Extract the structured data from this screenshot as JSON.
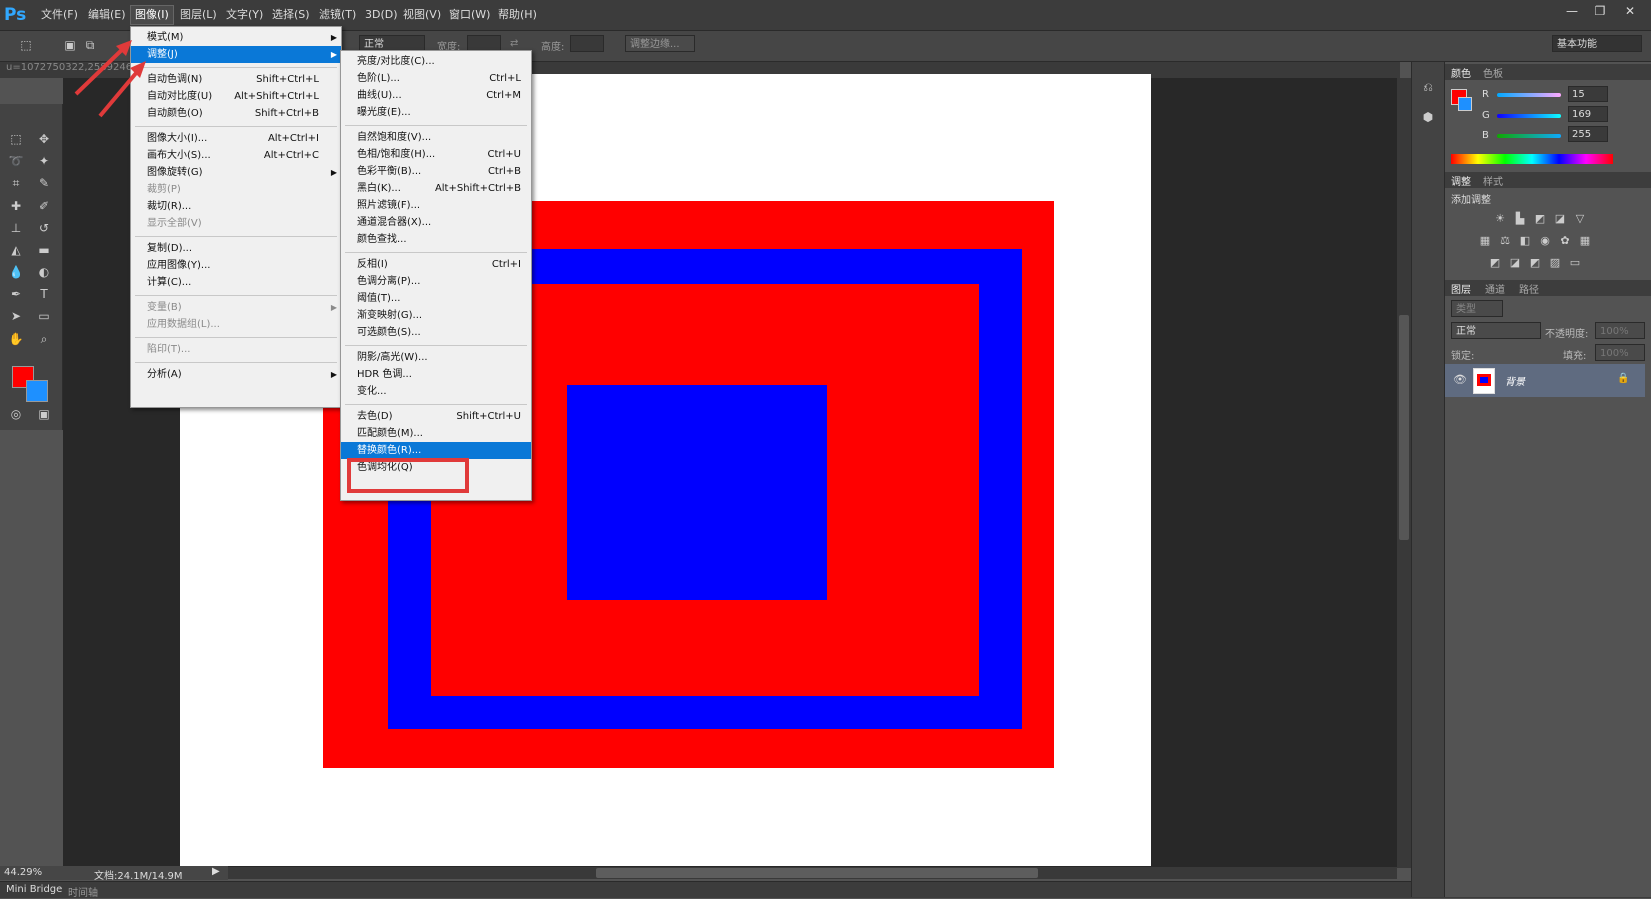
{
  "app": {
    "logo": "Ps"
  },
  "menubar": {
    "items": [
      "文件(F)",
      "编辑(E)",
      "图像(I)",
      "图层(L)",
      "文字(Y)",
      "选择(S)",
      "滤镜(T)",
      "3D(D)",
      "视图(V)",
      "窗口(W)",
      "帮助(H)"
    ],
    "active_index": 2
  },
  "window_controls": {
    "minimize": "—",
    "restore": "❐",
    "close": "✕"
  },
  "options_bar": {
    "style_value": "正常",
    "width_label": "宽度:",
    "height_label": "高度:",
    "refine_edge": "调整边缘...",
    "workspace": "基本功能"
  },
  "document_tab": {
    "title": "u=1072750322,2589246..."
  },
  "status": {
    "zoom": "44.29%",
    "doc_info": "文档:24.1M/14.9M"
  },
  "bottom_tabs": [
    "Mini Bridge",
    "时间轴"
  ],
  "colors": {
    "foreground": "#ff0000",
    "background": "#1e90ff",
    "canvas_red": "#ff0000",
    "canvas_blue": "#0000ff",
    "menu_highlight": "#0a78d7",
    "annotation": "#e03a3a"
  },
  "image_menu": {
    "items": [
      {
        "label": "模式(M)",
        "shortcut": "",
        "submenu": true,
        "disabled": false
      },
      {
        "label": "调整(J)",
        "shortcut": "",
        "submenu": true,
        "disabled": false,
        "highlighted": true
      },
      {
        "label": "自动色调(N)",
        "shortcut": "Shift+Ctrl+L"
      },
      {
        "label": "自动对比度(U)",
        "shortcut": "Alt+Shift+Ctrl+L"
      },
      {
        "label": "自动颜色(O)",
        "shortcut": "Shift+Ctrl+B"
      },
      {
        "label": "图像大小(I)...",
        "shortcut": "Alt+Ctrl+I"
      },
      {
        "label": "画布大小(S)...",
        "shortcut": "Alt+Ctrl+C"
      },
      {
        "label": "图像旋转(G)",
        "shortcut": "",
        "submenu": true
      },
      {
        "label": "裁剪(P)",
        "shortcut": "",
        "disabled": true
      },
      {
        "label": "裁切(R)...",
        "shortcut": ""
      },
      {
        "label": "显示全部(V)",
        "shortcut": "",
        "disabled": true
      },
      {
        "label": "复制(D)...",
        "shortcut": ""
      },
      {
        "label": "应用图像(Y)...",
        "shortcut": ""
      },
      {
        "label": "计算(C)...",
        "shortcut": ""
      },
      {
        "label": "变量(B)",
        "shortcut": "",
        "submenu": true,
        "disabled": true
      },
      {
        "label": "应用数据组(L)...",
        "shortcut": "",
        "disabled": true
      },
      {
        "label": "陷印(T)...",
        "shortcut": "",
        "disabled": true
      },
      {
        "label": "分析(A)",
        "shortcut": "",
        "submenu": true
      }
    ]
  },
  "adjust_menu": {
    "items": [
      {
        "label": "亮度/对比度(C)...",
        "shortcut": ""
      },
      {
        "label": "色阶(L)...",
        "shortcut": "Ctrl+L"
      },
      {
        "label": "曲线(U)...",
        "shortcut": "Ctrl+M"
      },
      {
        "label": "曝光度(E)...",
        "shortcut": ""
      },
      {
        "label": "自然饱和度(V)...",
        "shortcut": ""
      },
      {
        "label": "色相/饱和度(H)...",
        "shortcut": "Ctrl+U"
      },
      {
        "label": "色彩平衡(B)...",
        "shortcut": "Ctrl+B"
      },
      {
        "label": "黑白(K)...",
        "shortcut": "Alt+Shift+Ctrl+B"
      },
      {
        "label": "照片滤镜(F)...",
        "shortcut": ""
      },
      {
        "label": "通道混合器(X)...",
        "shortcut": ""
      },
      {
        "label": "颜色查找...",
        "shortcut": ""
      },
      {
        "label": "反相(I)",
        "shortcut": "Ctrl+I"
      },
      {
        "label": "色调分离(P)...",
        "shortcut": ""
      },
      {
        "label": "阈值(T)...",
        "shortcut": ""
      },
      {
        "label": "渐变映射(G)...",
        "shortcut": ""
      },
      {
        "label": "可选颜色(S)...",
        "shortcut": ""
      },
      {
        "label": "阴影/高光(W)...",
        "shortcut": ""
      },
      {
        "label": "HDR 色调...",
        "shortcut": ""
      },
      {
        "label": "变化...",
        "shortcut": ""
      },
      {
        "label": "去色(D)",
        "shortcut": "Shift+Ctrl+U"
      },
      {
        "label": "匹配颜色(M)...",
        "shortcut": ""
      },
      {
        "label": "替换颜色(R)...",
        "shortcut": "",
        "highlighted": true
      },
      {
        "label": "色调均化(Q)",
        "shortcut": ""
      }
    ]
  },
  "color_panel": {
    "tabs": [
      "颜色",
      "色板"
    ],
    "r_label": "R",
    "g_label": "G",
    "b_label": "B",
    "r": "15",
    "g": "169",
    "b": "255"
  },
  "adjustments_panel": {
    "tabs": [
      "调整",
      "样式"
    ],
    "heading": "添加调整"
  },
  "layers_panel": {
    "tabs": [
      "图层",
      "通道",
      "路径"
    ],
    "filter_kind": "类型",
    "blend_mode": "正常",
    "opacity_label": "不透明度:",
    "opacity": "100%",
    "lock_label": "锁定:",
    "fill_label": "填充:",
    "fill": "100%",
    "layer_name": "背景"
  }
}
